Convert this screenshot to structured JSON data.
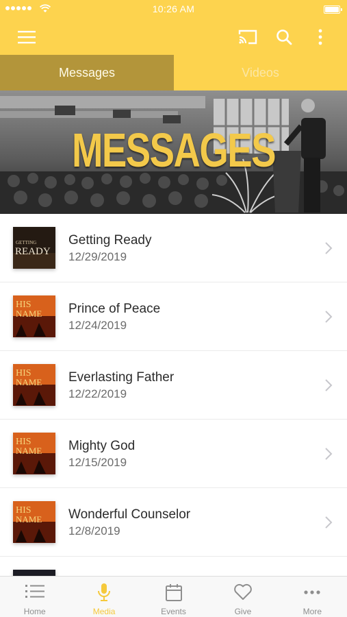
{
  "status_bar": {
    "time": "10:26 AM"
  },
  "header": {
    "icons": [
      "menu-icon",
      "cast-icon",
      "search-icon",
      "more-vertical-icon"
    ]
  },
  "tabs": [
    {
      "label": "Messages",
      "active": true
    },
    {
      "label": "Videos",
      "active": false
    }
  ],
  "banner": {
    "title": "MESSAGES"
  },
  "messages": [
    {
      "title": "Getting Ready",
      "date": "12/29/2019",
      "thumb_text": [
        "GETTING",
        "READY"
      ]
    },
    {
      "title": "Prince of Peace",
      "date": "12/24/2019",
      "thumb_text": [
        "HIS",
        "NAME"
      ]
    },
    {
      "title": "Everlasting Father",
      "date": "12/22/2019",
      "thumb_text": [
        "HIS",
        "NAME"
      ]
    },
    {
      "title": "Mighty God",
      "date": "12/15/2019",
      "thumb_text": [
        "HIS",
        "NAME"
      ]
    },
    {
      "title": "Wonderful Counselor",
      "date": "12/8/2019",
      "thumb_text": [
        "HIS",
        "NAME"
      ]
    }
  ],
  "bottom_tabs": [
    {
      "label": "Home",
      "icon": "list-icon",
      "active": false
    },
    {
      "label": "Media",
      "icon": "microphone-icon",
      "active": true
    },
    {
      "label": "Events",
      "icon": "calendar-icon",
      "active": false
    },
    {
      "label": "Give",
      "icon": "heart-icon",
      "active": false
    },
    {
      "label": "More",
      "icon": "ellipsis-icon",
      "active": false
    }
  ],
  "colors": {
    "brand_yellow": "#fdd34e",
    "active_tab": "#b3953a",
    "accent_text": "#f5c93c"
  }
}
